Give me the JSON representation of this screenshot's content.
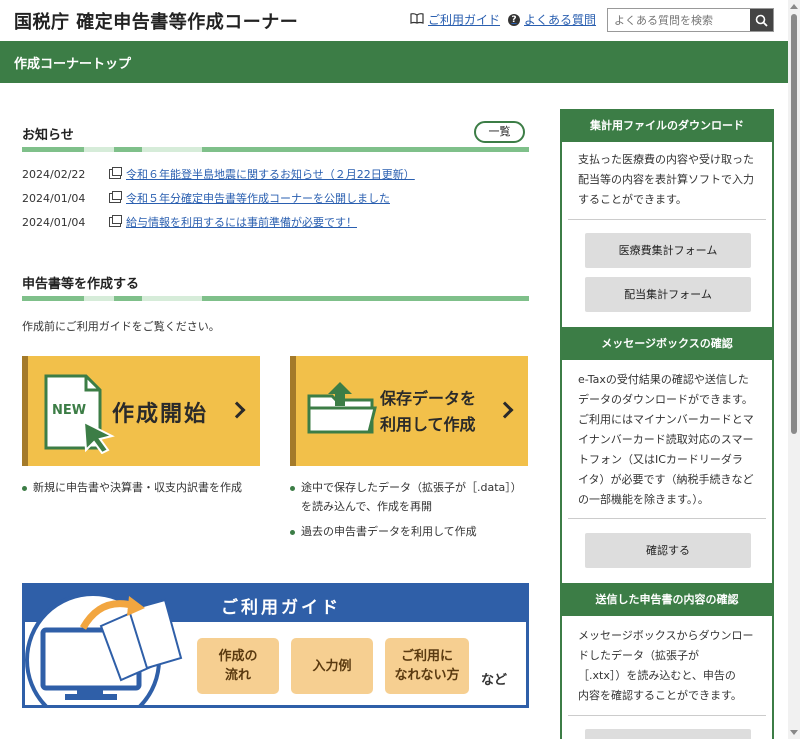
{
  "header": {
    "title": "国税庁 確定申告書等作成コーナー",
    "guide_link": "ご利用ガイド",
    "faq_link": "よくある質問",
    "search_placeholder": "よくある質問を検索"
  },
  "navbar": {
    "label": "作成コーナートップ"
  },
  "news": {
    "title": "お知らせ",
    "more_label": "一覧",
    "items": [
      {
        "date": "2024/02/22",
        "text": "令和６年能登半島地震に関するお知らせ（２月22日更新）"
      },
      {
        "date": "2024/01/04",
        "text": "令和５年分確定申告書等作成コーナーを公開しました"
      },
      {
        "date": "2024/01/04",
        "text": "給与情報を利用するには事前準備が必要です！"
      }
    ]
  },
  "create": {
    "title": "申告書等を作成する",
    "intro": "作成前にご利用ガイドをご覧ください。",
    "tile_new": {
      "badge": "NEW",
      "label": "作成開始"
    },
    "tile_saved": {
      "label_line1": "保存データを",
      "label_line2": "利用して作成"
    },
    "new_bullets": [
      "新規に申告書や決算書・収支内訳書を作成"
    ],
    "saved_bullets": [
      "途中で保存したデータ（拡張子が［.data］）",
      "を読み込んで、作成を再開",
      "過去の申告書データを利用して作成"
    ]
  },
  "guide_banner": {
    "title": "ご利用ガイド",
    "chips": [
      {
        "line1": "作成の",
        "line2": "流れ"
      },
      {
        "line1": "入力例",
        "line2": ""
      },
      {
        "line1": "ご利用に",
        "line2": "なれない方"
      }
    ],
    "etc": "など"
  },
  "sidebar": {
    "download": {
      "head": "集計用ファイルのダウンロード",
      "text": [
        "支払った医療費の内容や受け取った",
        "配当等の内容を表計算ソフトで入力",
        "することができます。"
      ],
      "buttons": [
        "医療費集計フォーム",
        "配当集計フォーム"
      ]
    },
    "messagebox": {
      "head": "メッセージボックスの確認",
      "text": [
        "e-Taxの受付結果の確認や送信した",
        "データのダウンロードができます。",
        "ご利用にはマイナンバーカードとマ",
        "イナンバーカード読取対応のスマー",
        "トフォン（又はICカードリーダラ",
        "イタ）が必要です（納税手続きなど",
        "の一部機能を除きます。）。"
      ],
      "button": "確認する"
    },
    "sent": {
      "head": "送信した申告書の内容の確認",
      "text": [
        "メッセージボックスからダウンロー",
        "ドしたデータ（拡張子が",
        "［.xtx］）を読み込むと、申告の",
        "内容を確認することができます。"
      ]
    }
  },
  "colors": {
    "green": "#3c7d46",
    "tile": "#f2c04a",
    "guide_blue": "#2f5fa8",
    "link": "#2a5fb0"
  }
}
